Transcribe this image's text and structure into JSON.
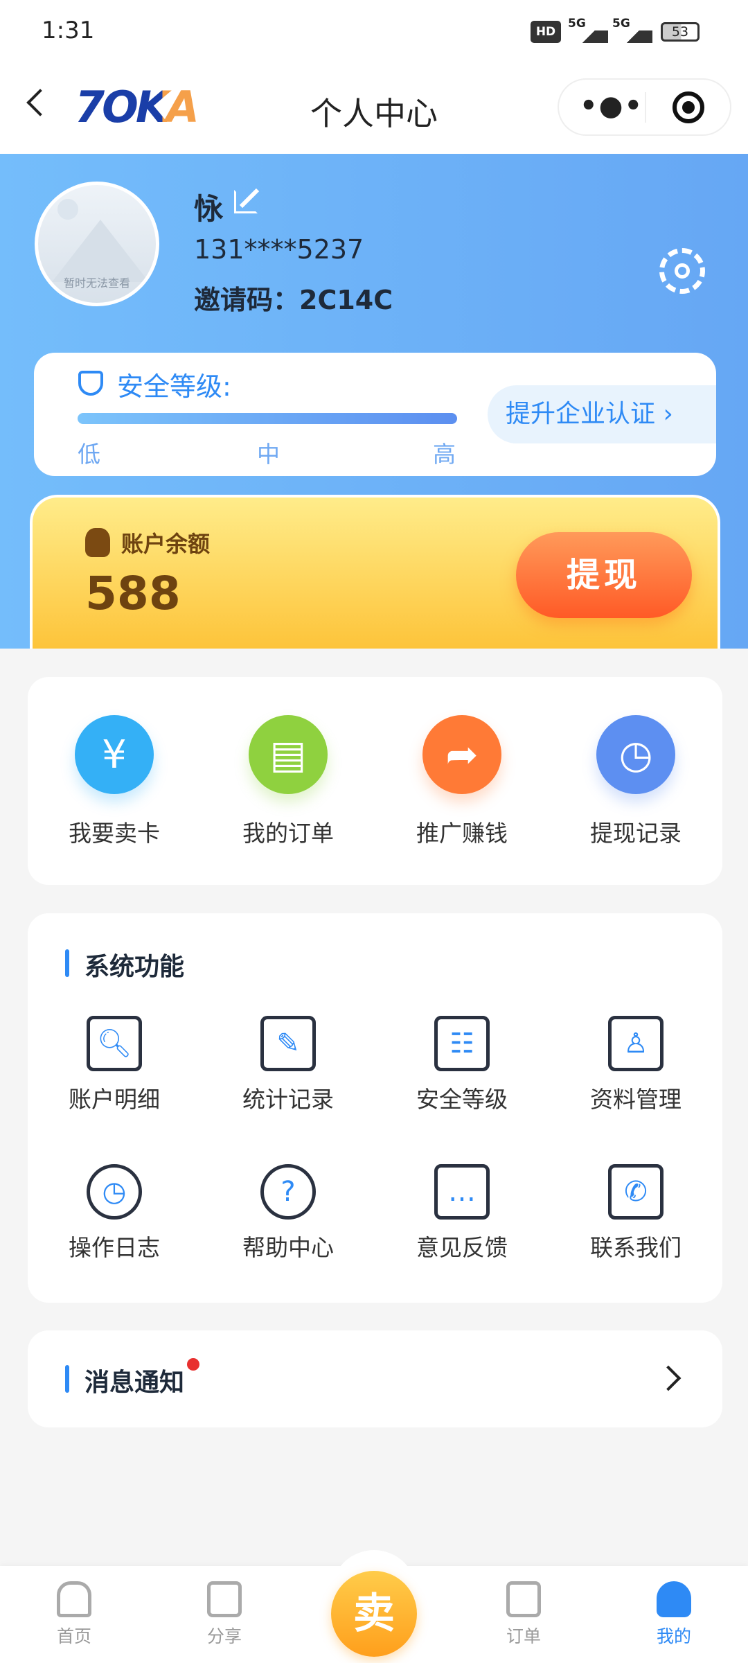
{
  "status": {
    "time": "1:31",
    "network": "5G",
    "battery": "53",
    "hd": "HD"
  },
  "nav": {
    "logo": "7OKA",
    "title": "个人中心",
    "more_icon": "more-dots-icon",
    "target_icon": "record-target-icon"
  },
  "profile": {
    "name": "怺",
    "phone": "131****5237",
    "invite_label": "邀请码：",
    "invite_code": "2C14C",
    "avatar_placeholder": "暂时无法查看"
  },
  "security": {
    "title": "安全等级:",
    "levels": [
      "低",
      "中",
      "高"
    ],
    "level_fill": 1.0,
    "upgrade_label": "提升企业认证",
    "accent": "#2e8af5"
  },
  "balance": {
    "label": "账户余额",
    "amount": "588",
    "withdraw_label": "提现"
  },
  "quick": [
    {
      "label": "我要卖卡",
      "icon": "money-bag-icon",
      "color": "#34b0f6"
    },
    {
      "label": "我的订单",
      "icon": "order-doc-icon",
      "color": "#8fd13f"
    },
    {
      "label": "推广赚钱",
      "icon": "share-arrow-icon",
      "color": "#ff7a36"
    },
    {
      "label": "提现记录",
      "icon": "clock-icon",
      "color": "#5d8ff1"
    }
  ],
  "system": {
    "title": "系统功能",
    "items": [
      {
        "label": "账户明细",
        "icon": "doc-search-icon"
      },
      {
        "label": "统计记录",
        "icon": "doc-edit-icon"
      },
      {
        "label": "安全等级",
        "icon": "id-card-icon"
      },
      {
        "label": "资料管理",
        "icon": "user-icon"
      },
      {
        "label": "操作日志",
        "icon": "clock-icon"
      },
      {
        "label": "帮助中心",
        "icon": "question-icon"
      },
      {
        "label": "意见反馈",
        "icon": "chat-dots-icon"
      },
      {
        "label": "联系我们",
        "icon": "phone-icon"
      }
    ]
  },
  "message": {
    "title": "消息通知"
  },
  "tabbar": {
    "items": [
      {
        "label": "首页"
      },
      {
        "label": "分享"
      },
      {
        "label": "卖"
      },
      {
        "label": "订单"
      },
      {
        "label": "我的"
      }
    ],
    "active": "我的",
    "active_color": "#2e8af5"
  }
}
